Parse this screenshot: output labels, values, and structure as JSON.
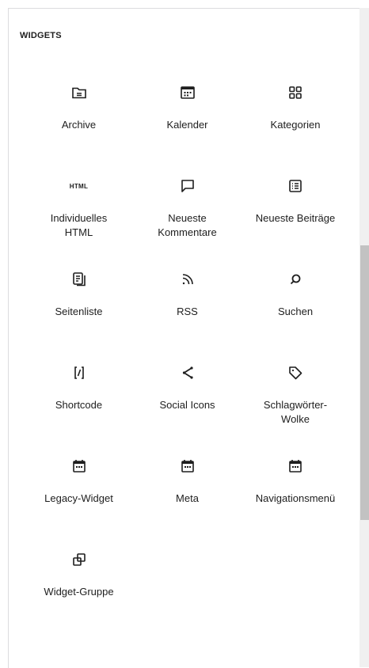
{
  "section": {
    "title": "WIDGETS"
  },
  "widgets": [
    {
      "label": "Archive",
      "icon": "archive-folder-icon"
    },
    {
      "label": "Kalender",
      "icon": "calendar-icon"
    },
    {
      "label": "Kategorien",
      "icon": "grid-icon"
    },
    {
      "label": "Individuelles HTML",
      "icon": "html-icon",
      "icon_text": "HTML"
    },
    {
      "label": "Neueste Kommentare",
      "icon": "comment-bubble-icon"
    },
    {
      "label": "Neueste Beiträge",
      "icon": "post-list-icon"
    },
    {
      "label": "Seitenliste",
      "icon": "pages-icon"
    },
    {
      "label": "RSS",
      "icon": "rss-icon"
    },
    {
      "label": "Suchen",
      "icon": "search-icon"
    },
    {
      "label": "Shortcode",
      "icon": "shortcode-icon"
    },
    {
      "label": "Social Icons",
      "icon": "share-icon"
    },
    {
      "label": "Schlagwörter-Wolke",
      "icon": "tag-icon"
    },
    {
      "label": "Legacy-Widget",
      "icon": "legacy-widget-icon"
    },
    {
      "label": "Meta",
      "icon": "legacy-widget-icon"
    },
    {
      "label": "Navigationsmenü",
      "icon": "legacy-widget-icon"
    },
    {
      "label": "Widget-Gruppe",
      "icon": "widget-group-icon"
    }
  ]
}
